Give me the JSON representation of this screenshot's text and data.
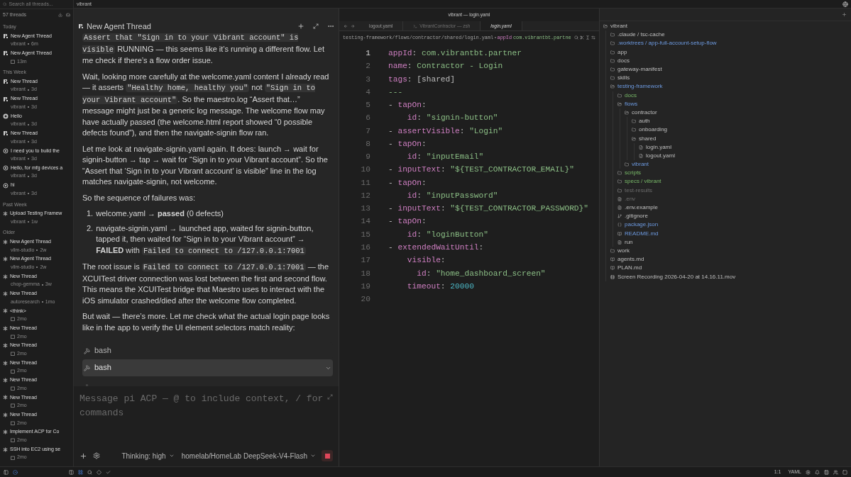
{
  "sidebar": {
    "search": {
      "placeholder": "Search all threads..."
    },
    "thread_count": "57 threads",
    "groups": [
      {
        "label": "Today",
        "threads": [
          {
            "title": "New Agent Thread",
            "project": "vibrant",
            "age": "6m",
            "kind": "pi"
          },
          {
            "title": "New Agent Thread",
            "age": "13m",
            "kind": "pi"
          }
        ]
      },
      {
        "label": "This Week",
        "threads": [
          {
            "title": "New Thread",
            "project": "vibrant",
            "age": "3d",
            "kind": "pi"
          },
          {
            "title": "New Thread",
            "project": "vibrant",
            "age": "3d",
            "kind": "pi"
          },
          {
            "title": "Hello",
            "project": "vibrant",
            "age": "3d",
            "kind": "badge"
          },
          {
            "title": "New Thread",
            "project": "vibrant",
            "age": "3d",
            "kind": "pi"
          },
          {
            "title": "I need you to build the",
            "project": "vibrant",
            "age": "3d",
            "kind": "ring"
          },
          {
            "title": "Hello, for mfg devices a",
            "project": "vibrant",
            "age": "3d",
            "kind": "ring"
          },
          {
            "title": "hi",
            "project": "vibrant",
            "age": "3d",
            "kind": "ring"
          }
        ]
      },
      {
        "label": "Past Week",
        "threads": [
          {
            "title": "Upload Testing Framew",
            "project": "vibrant",
            "age": "1w",
            "kind": "star"
          }
        ]
      },
      {
        "label": "Older",
        "threads": [
          {
            "title": "New Agent Thread",
            "project": "vllm-studio",
            "age": "2w",
            "kind": "star"
          },
          {
            "title": "New Agent Thread",
            "project": "vllm-studio",
            "age": "2w",
            "kind": "star"
          },
          {
            "title": "New Thread",
            "project": "chop-gemma",
            "age": "3w",
            "kind": "star"
          },
          {
            "title": "New Thread",
            "project": "autoresearch",
            "age": "1mo",
            "kind": "star"
          },
          {
            "title": "<think>",
            "age": "2mo",
            "kind": "star"
          },
          {
            "title": "New Thread",
            "age": "2mo",
            "kind": "star"
          },
          {
            "title": "New Thread",
            "age": "2mo",
            "kind": "star"
          },
          {
            "title": "New Thread",
            "age": "2mo",
            "kind": "star"
          },
          {
            "title": "New Thread",
            "age": "2mo",
            "kind": "star"
          },
          {
            "title": "New Thread",
            "age": "2mo",
            "kind": "star"
          },
          {
            "title": "New Thread",
            "age": "2mo",
            "kind": "star"
          },
          {
            "title": "Implement ACP for Co",
            "age": "2mo",
            "kind": "star"
          },
          {
            "title": "SSH into EC2 using se",
            "age": "2mo",
            "kind": "star"
          }
        ]
      }
    ]
  },
  "top_bar": {
    "workspace": "vibrant",
    "window_title": "vibrant — login.yaml"
  },
  "chat": {
    "title": "New Agent Thread",
    "blocks": [
      {
        "kind": "paragraph",
        "segments": [
          {
            "kind": "code",
            "text": "Assert that \"Sign in to your Vibrant account\" is visible"
          },
          {
            "kind": "text",
            "text": " RUNNING — this seems like it’s running a different flow. Let me check if there’s a flow order issue."
          }
        ]
      },
      {
        "kind": "paragraph",
        "segments": [
          {
            "kind": "text",
            "text": "Wait, looking more carefully at the welcome.yaml content I already read — it asserts "
          },
          {
            "kind": "code",
            "text": "\"Healthy home, healthy you\""
          },
          {
            "kind": "text",
            "text": " not "
          },
          {
            "kind": "code",
            "text": "\"Sign in to your Vibrant account\""
          },
          {
            "kind": "text",
            "text": ". So the maestro.log “Assert that…” message might just be a generic log message. The welcome flow may have actually passed (the welcome.html report showed “0 possible defects found”), and then the navigate-signin flow ran."
          }
        ]
      },
      {
        "kind": "paragraph",
        "segments": [
          {
            "kind": "text",
            "text": "Let me look at navigate-signin.yaml again. It does: launch → wait for signin-button → tap → wait for “Sign in to your Vibrant account”. So the “Assert that ‘Sign in to your Vibrant account’ is visible” line in the log matches navigate-signin, not welcome."
          }
        ]
      },
      {
        "kind": "paragraph",
        "segments": [
          {
            "kind": "text",
            "text": "So the sequence of failures was:"
          }
        ]
      },
      {
        "kind": "list",
        "items": [
          {
            "number": "1.",
            "segments": [
              {
                "kind": "text",
                "text": "welcome.yaml → **passed** (0 defects)"
              }
            ]
          },
          {
            "number": "2.",
            "segments": [
              {
                "kind": "text",
                "text": "navigate-signin.yaml → launched app, waited for signin-button, tapped it, then waited for “Sign in to your Vibrant account” → **FAILED** with "
              },
              {
                "kind": "code",
                "text": "Failed to connect to /127.0.0.1:7001"
              }
            ]
          }
        ]
      },
      {
        "kind": "paragraph",
        "segments": [
          {
            "kind": "text",
            "text": "The root issue is "
          },
          {
            "kind": "code",
            "text": "Failed to connect to /127.0.0.1:7001"
          },
          {
            "kind": "text",
            "text": " — the XCUITest driver connection was lost between the first and second flow. This means the XCUITest bridge that Maestro uses to interact with the iOS simulator crashed/died after the welcome flow completed."
          }
        ]
      },
      {
        "kind": "paragraph",
        "segments": [
          {
            "kind": "text",
            "text": "But wait — there’s more. Let me check what the actual login page looks like in the app to verify the UI element selectors match reality:"
          }
        ]
      }
    ],
    "tool_calls": [
      {
        "name": "bash",
        "hovered": false
      },
      {
        "name": "bash",
        "hovered": true
      }
    ],
    "working": true,
    "composer": {
      "placeholder": "Message pi ACP — @ to include context, / for commands",
      "thinking": "Thinking: high",
      "model": "homelab/HomeLab DeepSeek-V4-Flash",
      "running": true
    }
  },
  "editor": {
    "tabs": [
      {
        "label": "logout.yaml",
        "kind": "file",
        "selected": false
      },
      {
        "label": "VibrantContractor — zsh",
        "kind": "terminal",
        "selected": false
      },
      {
        "label": "login.yaml",
        "kind": "file",
        "selected": true
      }
    ],
    "breadcrumb": {
      "path": "testing-framework/flows/contractor/shared/login.yaml",
      "symbol_key": "appId",
      "symbol_value": "com.vibrantbt.partne"
    },
    "lines": [
      {
        "number": "1",
        "current": true,
        "tokens": [
          {
            "kind": "key",
            "text": "appId"
          },
          {
            "kind": "punct",
            "text": ": "
          },
          {
            "kind": "string",
            "text": "com.vibrantbt.partner"
          }
        ]
      },
      {
        "number": "2",
        "current": false,
        "tokens": [
          {
            "kind": "key",
            "text": "name"
          },
          {
            "kind": "punct",
            "text": ": "
          },
          {
            "kind": "string",
            "text": "Contractor - Login"
          }
        ]
      },
      {
        "number": "3",
        "current": false,
        "tokens": [
          {
            "kind": "key",
            "text": "tags"
          },
          {
            "kind": "punct",
            "text": ": [shared]"
          }
        ]
      },
      {
        "number": "4",
        "current": false,
        "tokens": [
          {
            "kind": "string",
            "text": "---"
          }
        ]
      },
      {
        "number": "5",
        "current": false,
        "tokens": [
          {
            "kind": "punct",
            "text": "- "
          },
          {
            "kind": "key",
            "text": "tapOn"
          },
          {
            "kind": "punct",
            "text": ":"
          }
        ]
      },
      {
        "number": "6",
        "current": false,
        "tokens": [
          {
            "kind": "key",
            "text": "    id"
          },
          {
            "kind": "punct",
            "text": ": "
          },
          {
            "kind": "string",
            "text": "\"signin-button\""
          }
        ]
      },
      {
        "number": "7",
        "current": false,
        "tokens": [
          {
            "kind": "punct",
            "text": "- "
          },
          {
            "kind": "key",
            "text": "assertVisible"
          },
          {
            "kind": "punct",
            "text": ": "
          },
          {
            "kind": "string",
            "text": "\"Login\""
          }
        ]
      },
      {
        "number": "8",
        "current": false,
        "tokens": [
          {
            "kind": "punct",
            "text": "- "
          },
          {
            "kind": "key",
            "text": "tapOn"
          },
          {
            "kind": "punct",
            "text": ":"
          }
        ]
      },
      {
        "number": "9",
        "current": false,
        "tokens": [
          {
            "kind": "key",
            "text": "    id"
          },
          {
            "kind": "punct",
            "text": ": "
          },
          {
            "kind": "string",
            "text": "\"inputEmail\""
          }
        ]
      },
      {
        "number": "10",
        "current": false,
        "tokens": [
          {
            "kind": "punct",
            "text": "- "
          },
          {
            "kind": "key",
            "text": "inputText"
          },
          {
            "kind": "punct",
            "text": ": "
          },
          {
            "kind": "string",
            "text": "\"${TEST_CONTRACTOR_EMAIL}\""
          }
        ]
      },
      {
        "number": "11",
        "current": false,
        "tokens": [
          {
            "kind": "punct",
            "text": "- "
          },
          {
            "kind": "key",
            "text": "tapOn"
          },
          {
            "kind": "punct",
            "text": ":"
          }
        ]
      },
      {
        "number": "12",
        "current": false,
        "tokens": [
          {
            "kind": "key",
            "text": "    id"
          },
          {
            "kind": "punct",
            "text": ": "
          },
          {
            "kind": "string",
            "text": "\"inputPassword\""
          }
        ]
      },
      {
        "number": "13",
        "current": false,
        "tokens": [
          {
            "kind": "punct",
            "text": "- "
          },
          {
            "kind": "key",
            "text": "inputText"
          },
          {
            "kind": "punct",
            "text": ": "
          },
          {
            "kind": "string",
            "text": "\"${TEST_CONTRACTOR_PASSWORD}\""
          }
        ]
      },
      {
        "number": "14",
        "current": false,
        "tokens": [
          {
            "kind": "punct",
            "text": "- "
          },
          {
            "kind": "key",
            "text": "tapOn"
          },
          {
            "kind": "punct",
            "text": ":"
          }
        ]
      },
      {
        "number": "15",
        "current": false,
        "tokens": [
          {
            "kind": "key",
            "text": "    id"
          },
          {
            "kind": "punct",
            "text": ": "
          },
          {
            "kind": "string",
            "text": "\"loginButton\""
          }
        ]
      },
      {
        "number": "16",
        "current": false,
        "tokens": [
          {
            "kind": "punct",
            "text": "- "
          },
          {
            "kind": "key",
            "text": "extendedWaitUntil"
          },
          {
            "kind": "punct",
            "text": ":"
          }
        ]
      },
      {
        "number": "17",
        "current": false,
        "tokens": [
          {
            "kind": "key",
            "text": "    visible"
          },
          {
            "kind": "punct",
            "text": ":"
          }
        ]
      },
      {
        "number": "18",
        "current": false,
        "tokens": [
          {
            "kind": "key",
            "text": "      id"
          },
          {
            "kind": "punct",
            "text": ": "
          },
          {
            "kind": "string",
            "text": "\"home_dashboard_screen\""
          }
        ]
      },
      {
        "number": "19",
        "current": false,
        "tokens": [
          {
            "kind": "key",
            "text": "    timeout"
          },
          {
            "kind": "punct",
            "text": ": "
          },
          {
            "kind": "number",
            "text": "20000"
          }
        ]
      },
      {
        "number": "20",
        "current": false
      }
    ]
  },
  "file_tree": [
    {
      "name": "vibrant",
      "kind": "folder",
      "expanded": true,
      "modified": false,
      "untracked": false,
      "ignored": false,
      "children": [
        {
          "name": ".claude / tsc-cache",
          "kind": "folder",
          "expanded": false,
          "modified": false,
          "untracked": false,
          "ignored": false
        },
        {
          "name": ".worktrees / app-full-account-setup-flow",
          "kind": "folder",
          "expanded": false,
          "modified": true,
          "untracked": false,
          "ignored": false
        },
        {
          "name": "app",
          "kind": "folder",
          "expanded": false,
          "modified": false,
          "untracked": false,
          "ignored": false
        },
        {
          "name": "docs",
          "kind": "folder",
          "expanded": false,
          "modified": false,
          "untracked": false,
          "ignored": false
        },
        {
          "name": "gateway-manifest",
          "kind": "folder",
          "expanded": false,
          "modified": false,
          "untracked": false,
          "ignored": false
        },
        {
          "name": "skills",
          "kind": "folder",
          "expanded": false,
          "modified": false,
          "untracked": false,
          "ignored": false
        },
        {
          "name": "testing-framework",
          "kind": "folder",
          "expanded": true,
          "modified": true,
          "untracked": false,
          "ignored": false,
          "children": [
            {
              "name": "docs",
              "kind": "folder",
              "expanded": false,
              "modified": false,
              "untracked": true,
              "ignored": false
            },
            {
              "name": "flows",
              "kind": "folder",
              "expanded": true,
              "modified": true,
              "untracked": false,
              "ignored": false,
              "children": [
                {
                  "name": "contractor",
                  "kind": "folder",
                  "expanded": true,
                  "modified": false,
                  "untracked": false,
                  "ignored": false,
                  "children": [
                    {
                      "name": "auth",
                      "kind": "folder",
                      "expanded": false,
                      "modified": false,
                      "untracked": false,
                      "ignored": false
                    },
                    {
                      "name": "onboarding",
                      "kind": "folder",
                      "expanded": false,
                      "modified": false,
                      "untracked": false,
                      "ignored": false
                    },
                    {
                      "name": "shared",
                      "kind": "folder",
                      "expanded": true,
                      "modified": false,
                      "untracked": false,
                      "ignored": false,
                      "children": [
                        {
                          "name": "login.yaml",
                          "kind": "yaml",
                          "modified": false,
                          "untracked": false,
                          "ignored": false
                        },
                        {
                          "name": "logout.yaml",
                          "kind": "yaml",
                          "modified": false,
                          "untracked": false,
                          "ignored": false
                        }
                      ]
                    }
                  ]
                },
                {
                  "name": "vibrant",
                  "kind": "folder",
                  "expanded": false,
                  "modified": true,
                  "untracked": false,
                  "ignored": false
                }
              ]
            },
            {
              "name": "scripts",
              "kind": "folder",
              "expanded": false,
              "modified": false,
              "untracked": true,
              "ignored": false
            },
            {
              "name": "specs / vibrant",
              "kind": "folder",
              "expanded": false,
              "modified": false,
              "untracked": true,
              "ignored": false
            },
            {
              "name": "test-results",
              "kind": "folder",
              "expanded": false,
              "modified": false,
              "untracked": false,
              "ignored": true
            },
            {
              "name": ".env",
              "kind": "text",
              "modified": false,
              "untracked": false,
              "ignored": true
            },
            {
              "name": ".env.example",
              "kind": "text",
              "modified": false,
              "untracked": false,
              "ignored": false
            },
            {
              "name": ".gitignore",
              "kind": "git",
              "modified": false,
              "untracked": false,
              "ignored": false
            },
            {
              "name": "package.json",
              "kind": "json",
              "modified": true,
              "untracked": false,
              "ignored": false
            },
            {
              "name": "README.md",
              "kind": "markdown",
              "modified": true,
              "untracked": false,
              "ignored": false
            },
            {
              "name": "run",
              "kind": "text",
              "modified": false,
              "untracked": false,
              "ignored": false
            }
          ]
        },
        {
          "name": "work",
          "kind": "folder",
          "expanded": false,
          "modified": false,
          "untracked": false,
          "ignored": false
        },
        {
          "name": "agents.md",
          "kind": "markdown",
          "modified": false,
          "untracked": false,
          "ignored": false
        },
        {
          "name": "PLAN.md",
          "kind": "markdown",
          "modified": false,
          "untracked": false,
          "ignored": false
        },
        {
          "name": "Screen Recording 2026-04-20 at 14.16.11.mov",
          "kind": "video",
          "modified": false,
          "untracked": false,
          "ignored": false
        }
      ]
    }
  ],
  "status_bar": {
    "cursor": "1:1",
    "language": "YAML"
  }
}
